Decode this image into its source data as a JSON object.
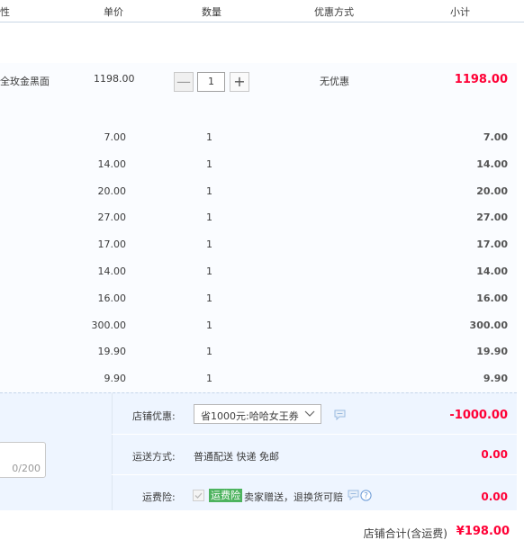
{
  "header": {
    "col_attr": "性",
    "col_price": "单价",
    "col_qty": "数量",
    "col_promo": "优惠方式",
    "col_subtotal": "小计"
  },
  "main_item": {
    "attr": "全玫金黑面",
    "price": "1198.00",
    "qty": "1",
    "minus_label": "—",
    "plus_label": "+",
    "promo": "无优惠",
    "subtotal": "1198.00"
  },
  "items": [
    {
      "price": "7.00",
      "qty": "1",
      "subtotal": "7.00"
    },
    {
      "price": "14.00",
      "qty": "1",
      "subtotal": "14.00"
    },
    {
      "price": "20.00",
      "qty": "1",
      "subtotal": "20.00"
    },
    {
      "price": "27.00",
      "qty": "1",
      "subtotal": "27.00"
    },
    {
      "price": "17.00",
      "qty": "1",
      "subtotal": "17.00"
    },
    {
      "price": "14.00",
      "qty": "1",
      "subtotal": "14.00"
    },
    {
      "price": "16.00",
      "qty": "1",
      "subtotal": "16.00"
    },
    {
      "price": "300.00",
      "qty": "1",
      "subtotal": "300.00"
    },
    {
      "price": "19.90",
      "qty": "1",
      "subtotal": "19.90"
    },
    {
      "price": "9.90",
      "qty": "1",
      "subtotal": "9.90"
    }
  ],
  "shop": {
    "discount_label": "店铺优惠:",
    "discount_value": "省1000元:哈哈女王券",
    "discount_amount": "-1000.00",
    "shipping_label": "运送方式:",
    "shipping_value": "普通配送 快递 免邮",
    "shipping_amount": "0.00",
    "insurance_label": "运费险:",
    "insurance_badge": "运费险",
    "insurance_text": "卖家赠送，退换货可赔",
    "insurance_amount": "0.00",
    "note_counter": "0/200",
    "total_label": "店铺合计(含运费)",
    "total_value": "¥198.00"
  },
  "colors": {
    "price_red": "#ff0036",
    "insurance_green": "#4db35e",
    "header_border": "#c9d7e5"
  }
}
